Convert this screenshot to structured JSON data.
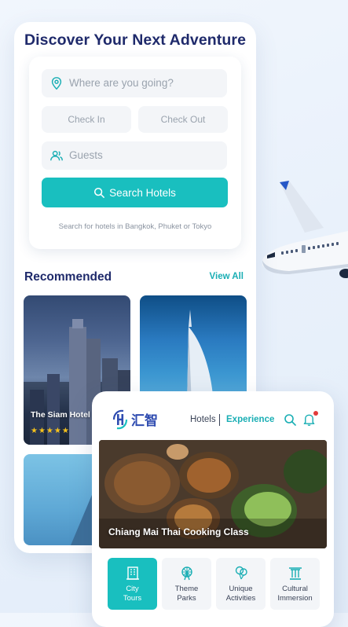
{
  "discover": {
    "title": "Discover Your Next Adventure",
    "destination_placeholder": "Where are you going?",
    "check_in": "Check In",
    "check_out": "Check Out",
    "guests": "Guests",
    "search_button": "Search Hotels",
    "hint": "Search for hotels in Bangkok, Phuket or Tokyo"
  },
  "recommended": {
    "title": "Recommended",
    "view_all": "View All",
    "hotels": [
      {
        "name": "The Siam Hotel",
        "stars": "★★★★★"
      }
    ]
  },
  "experience_app": {
    "logo_text": "汇智",
    "nav": {
      "hotels": "Hotels",
      "experience": "Experience"
    },
    "hero_title": "Chiang Mai Thai Cooking Class",
    "categories": [
      {
        "line1": "City",
        "line2": "Tours",
        "icon": "building-icon",
        "active": true
      },
      {
        "line1": "Theme",
        "line2": "Parks",
        "icon": "ferris-wheel-icon",
        "active": false
      },
      {
        "line1": "Unique",
        "line2": "Activities",
        "icon": "balloon-icon",
        "active": false
      },
      {
        "line1": "Cultural",
        "line2": "Immersion",
        "icon": "column-icon",
        "active": false
      }
    ]
  },
  "colors": {
    "accent": "#19bfbf",
    "heading": "#1f2a6b",
    "link": "#19aeb4"
  }
}
